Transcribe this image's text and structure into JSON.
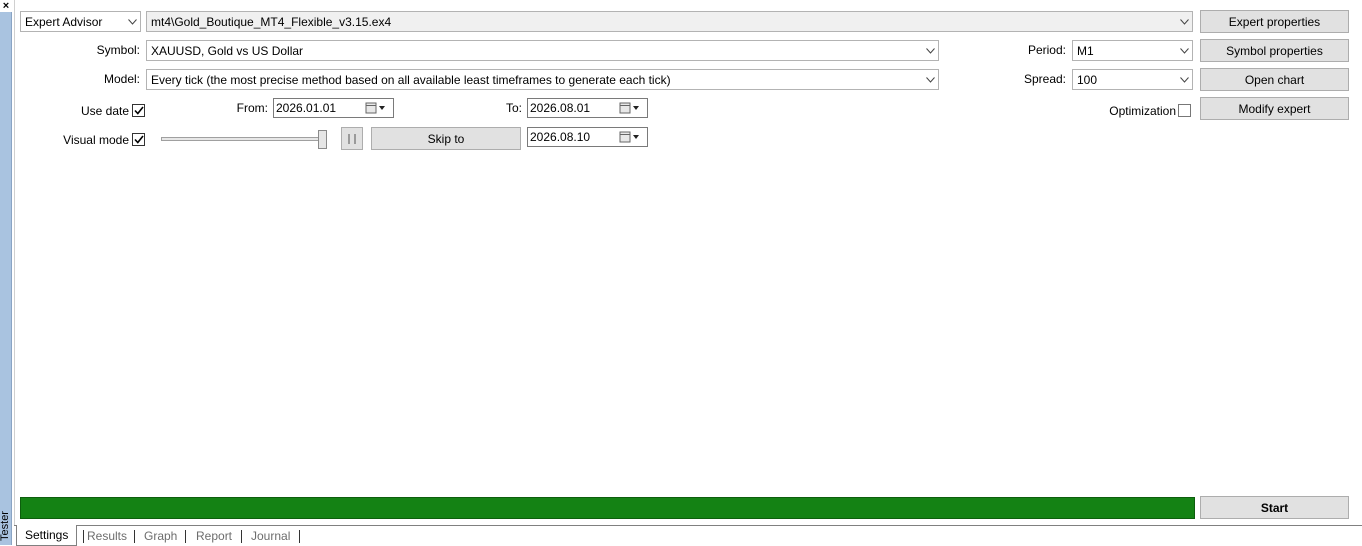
{
  "side": {
    "close_glyph": "×",
    "label": "Tester"
  },
  "header": {
    "type_combo": "Expert Advisor",
    "expert_combo": "mt4\\Gold_Boutique_MT4_Flexible_v3.15.ex4"
  },
  "symbol": {
    "label": "Symbol:",
    "value": "XAUUSD, Gold vs US Dollar"
  },
  "model": {
    "label": "Model:",
    "value": "Every tick (the most precise method based on all available least timeframes to generate each tick)"
  },
  "period": {
    "label": "Period:",
    "value": "M1"
  },
  "spread": {
    "label": "Spread:",
    "value": "100"
  },
  "use_date": {
    "label": "Use date",
    "checked": true
  },
  "from": {
    "label": "From:",
    "value": "2026.01.01"
  },
  "to": {
    "label": "To:",
    "value": "2026.08.01"
  },
  "optimization": {
    "label": "Optimization",
    "checked": false
  },
  "visual_mode": {
    "label": "Visual mode",
    "checked": true,
    "speed_fraction": 1.0
  },
  "skip": {
    "label": "Skip to",
    "value": "2026.08.10"
  },
  "buttons": {
    "expert_properties": "Expert properties",
    "symbol_properties": "Symbol properties",
    "open_chart": "Open chart",
    "modify_expert": "Modify expert",
    "start": "Start"
  },
  "progress": {
    "fraction": 1.0,
    "color": "#148214"
  },
  "tabs": [
    {
      "label": "Settings",
      "active": true
    },
    {
      "label": "Results",
      "active": false
    },
    {
      "label": "Graph",
      "active": false
    },
    {
      "label": "Report",
      "active": false
    },
    {
      "label": "Journal",
      "active": false
    }
  ]
}
